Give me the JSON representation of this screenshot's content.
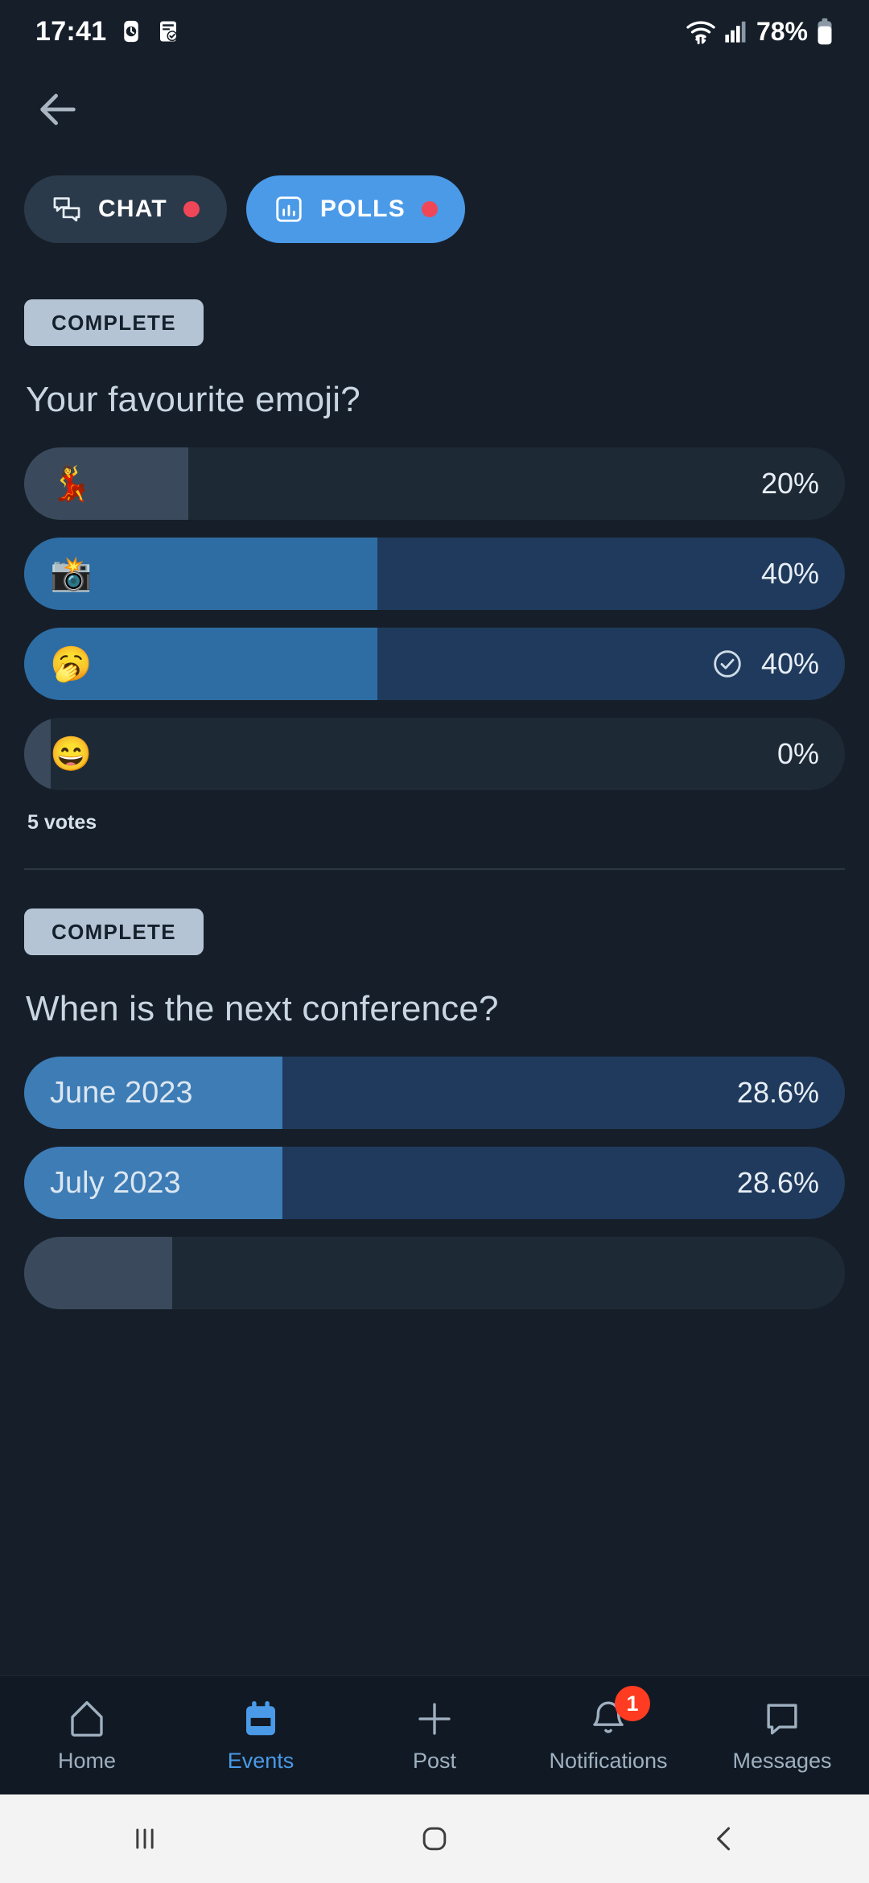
{
  "status_bar": {
    "time": "17:41",
    "battery_text": "78%",
    "icons": [
      "clock-icon",
      "task-note-icon",
      "wifi-icon",
      "signal-icon",
      "battery-icon"
    ]
  },
  "app_bar": {
    "back_icon": "back-arrow-icon"
  },
  "tabs": [
    {
      "label": "CHAT",
      "icon": "chat-bubbles-icon",
      "active": false,
      "has_dot": true
    },
    {
      "label": "POLLS",
      "icon": "bar-chart-icon",
      "active": true,
      "has_dot": true
    }
  ],
  "polls": [
    {
      "status": "COMPLETE",
      "question": "Your favourite emoji?",
      "votes_text": "5 votes",
      "options": [
        {
          "emoji": "💃",
          "label": "",
          "percent_text": "20%",
          "percent": 20,
          "selected": false,
          "style": "muted"
        },
        {
          "emoji": "📸",
          "label": "",
          "percent_text": "40%",
          "percent": 40,
          "selected": false,
          "style": "blue"
        },
        {
          "emoji": "🥱",
          "label": "",
          "percent_text": "40%",
          "percent": 40,
          "selected": true,
          "style": "blue"
        },
        {
          "emoji": "😄",
          "label": "",
          "percent_text": "0%",
          "percent": 0,
          "selected": false,
          "style": "muted"
        }
      ]
    },
    {
      "status": "COMPLETE",
      "question": "When is the next conference?",
      "votes_text": "",
      "options": [
        {
          "emoji": "",
          "label": "June 2023",
          "percent_text": "28.6%",
          "percent": 28.6,
          "selected": false,
          "style": "blue"
        },
        {
          "emoji": "",
          "label": "July 2023",
          "percent_text": "28.6%",
          "percent": 28.6,
          "selected": false,
          "style": "blue"
        },
        {
          "emoji": "",
          "label": "",
          "percent_text": "",
          "percent": 14,
          "selected": false,
          "style": "muted"
        }
      ]
    }
  ],
  "bottom_nav": [
    {
      "label": "Home",
      "icon": "home-icon",
      "active": false,
      "badge": ""
    },
    {
      "label": "Events",
      "icon": "calendar-icon",
      "active": true,
      "badge": ""
    },
    {
      "label": "Post",
      "icon": "plus-icon",
      "active": false,
      "badge": ""
    },
    {
      "label": "Notifications",
      "icon": "bell-icon",
      "active": false,
      "badge": "1"
    },
    {
      "label": "Messages",
      "icon": "message-icon",
      "active": false,
      "badge": ""
    }
  ],
  "system_nav": {
    "recents": "recents-icon",
    "home": "home-circle-icon",
    "back": "back-chevron-icon"
  },
  "colors": {
    "background": "#161f29",
    "accent_blue": "#4a9ae8",
    "bar_blue_fill": "#2e6da4",
    "bar_blue_track": "#1f3a5c",
    "bar_muted_fill": "#3a4a5c",
    "bar_muted_track": "#1e2936",
    "badge_bg": "#b5c4d4",
    "dot_red": "#ef4758",
    "notif_red": "#ff3b21"
  }
}
